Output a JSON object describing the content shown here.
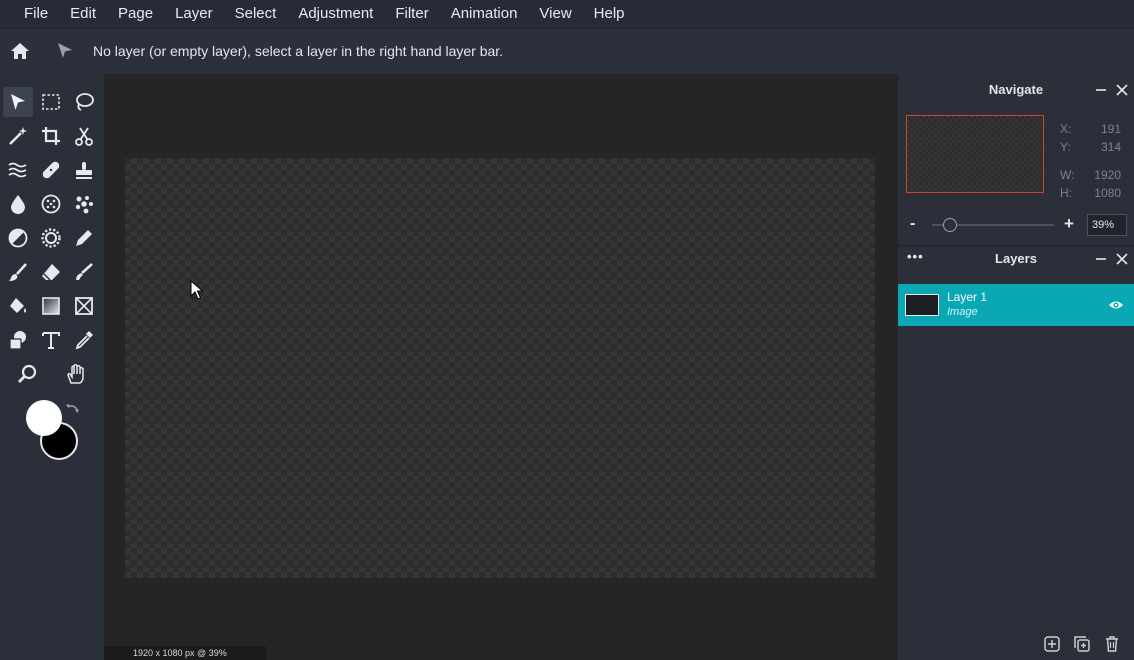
{
  "menu": {
    "items": [
      "File",
      "Edit",
      "Page",
      "Layer",
      "Select",
      "Adjustment",
      "Filter",
      "Animation",
      "View",
      "Help"
    ]
  },
  "options_bar": {
    "message": "No layer (or empty layer), select a layer in the right hand layer bar."
  },
  "toolbox": {
    "tools": [
      "move-tool",
      "marquee-select-tool",
      "lasso-tool",
      "magic-wand-tool",
      "crop-tool",
      "cut-tool",
      "liquify-tool",
      "healing-tool",
      "clone-stamp-tool",
      "blur-tool",
      "sponge-tool",
      "bloat-tool",
      "dodge-burn-tool",
      "color-replace-tool",
      "pencil-tool",
      "brush-tool",
      "eraser-tool",
      "smudge-tool",
      "paint-bucket-tool",
      "gradient-tool",
      "shape-tool",
      "shape-fill-tool",
      "text-tool",
      "eyedropper-tool",
      "zoom-tool",
      "hand-tool"
    ],
    "active_tool": "move-tool",
    "foreground_color": "#ffffff",
    "background_color": "#000000"
  },
  "canvas": {
    "status": "1920 x 1080 px @ 39%"
  },
  "navigate": {
    "title": "Navigate",
    "x_label": "X:",
    "x_value": "191",
    "y_label": "Y:",
    "y_value": "314",
    "w_label": "W:",
    "w_value": "1920",
    "h_label": "H:",
    "h_value": "1080",
    "zoom_minus": "-",
    "zoom_plus": "+",
    "zoom_value": "39%",
    "zoom_fraction": 0.15
  },
  "layers": {
    "title": "Layers",
    "more": "•••",
    "items": [
      {
        "name": "Layer 1",
        "type": "Image",
        "visible": true
      }
    ]
  },
  "colors": {
    "accent": "#0aa8b5",
    "nav_frame": "#c8462a"
  }
}
